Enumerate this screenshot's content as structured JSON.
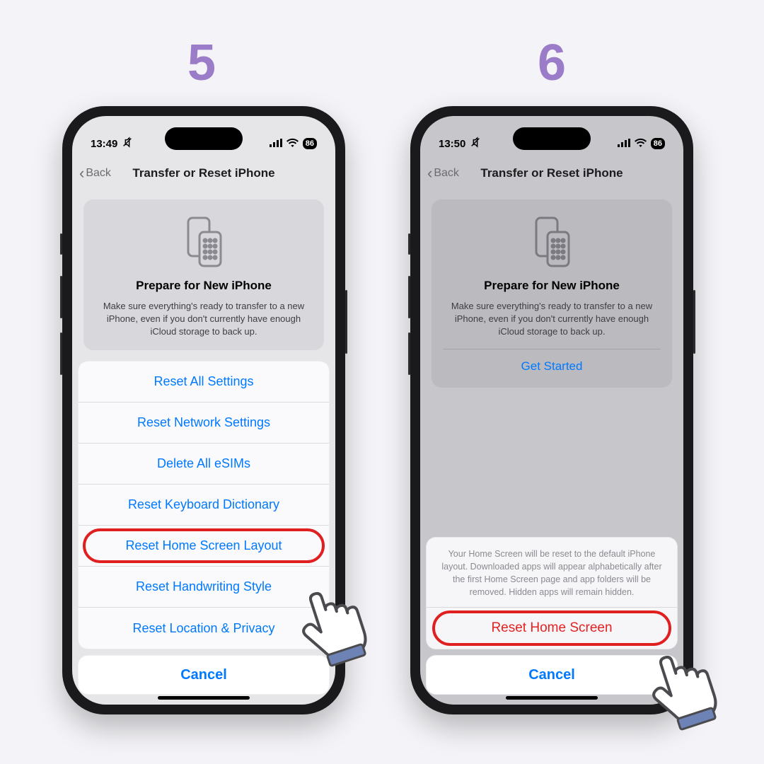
{
  "steps": {
    "left": "5",
    "right": "6"
  },
  "phone1": {
    "status": {
      "time": "13:49",
      "battery": "86"
    },
    "nav": {
      "back": "Back",
      "title": "Transfer or Reset iPhone"
    },
    "card": {
      "title": "Prepare for New iPhone",
      "desc": "Make sure everything's ready to transfer to a new iPhone, even if you don't currently have enough iCloud storage to back up."
    },
    "options": [
      "Reset All Settings",
      "Reset Network Settings",
      "Delete All eSIMs",
      "Reset Keyboard Dictionary",
      "Reset Home Screen Layout",
      "Reset Handwriting Style",
      "Reset Location & Privacy"
    ],
    "cancel": "Cancel"
  },
  "phone2": {
    "status": {
      "time": "13:50",
      "battery": "86"
    },
    "nav": {
      "back": "Back",
      "title": "Transfer or Reset iPhone"
    },
    "card": {
      "title": "Prepare for New iPhone",
      "desc": "Make sure everything's ready to transfer to a new iPhone, even if you don't currently have enough iCloud storage to back up.",
      "get_started": "Get Started"
    },
    "confirm": {
      "message": "Your Home Screen will be reset to the default iPhone layout. Downloaded apps will appear alphabetically after the first Home Screen page and app folders will be removed. Hidden apps will remain hidden.",
      "action": "Reset Home Screen"
    },
    "cancel": "Cancel"
  }
}
